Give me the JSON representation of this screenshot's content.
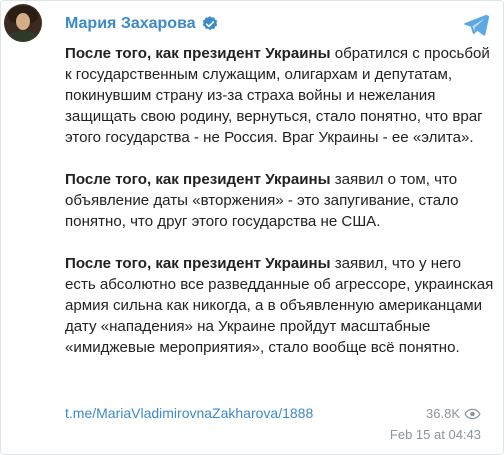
{
  "channel": {
    "name": "Мария Захарова",
    "verified": true,
    "accent_color": "#3c8ac9"
  },
  "post": {
    "paragraphs": [
      {
        "bold": "После того, как президент Украины",
        "text": " обратился с просьбой к государственным служащим, олигархам и депутатам, покинувшим страну из-за страха войны и нежелания защищать свою родину, вернуться, стало понятно, что враг этого государства - не Россия. Враг Украины - ее «элита»."
      },
      {
        "bold": "После того, как президент Украины",
        "text": " заявил о том, что объявление даты «вторжения» - это запугивание, стало понятно, что друг этого государства не США."
      },
      {
        "bold": "После того, как президент Украины",
        "text": " заявил, что у него есть абсолютно все разведданные об агрессоре, украинская армия сильна как никогда, а в объявленную американцами дату «нападения» на Украине пройдут масштабные «имиджевые мероприятия», стало вообще всё понятно."
      }
    ],
    "link": "t.me/MariaVladimirovnaZakharova/1888",
    "views": "36.8K",
    "date": "Feb 15 at 04:43"
  },
  "icons": {
    "verified": "verified-badge-icon",
    "telegram": "telegram-logo-icon",
    "views": "eye-icon"
  }
}
